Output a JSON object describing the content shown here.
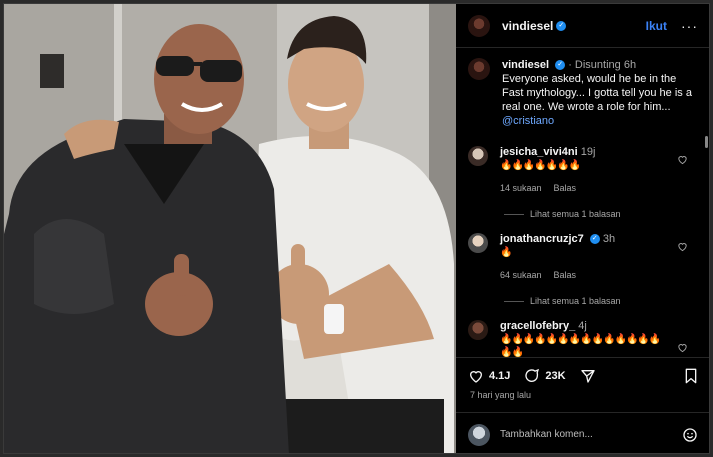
{
  "post": {
    "username": "vindiesel",
    "follow_label": "Ikut",
    "more_label": "···",
    "photo_alt": "Vin Diesel and Cristiano Ronaldo giving thumbs up"
  },
  "caption": {
    "username": "vindiesel",
    "edited": "· Disunting",
    "time": "6h",
    "text": "Everyone asked, would he be in the Fast mythology... I gotta tell you he is a real one.  We wrote a role for him...",
    "mention": "@cristiano"
  },
  "comments": [
    {
      "username": "jesicha_vivi4ni",
      "time": "19j",
      "text": "🔥🔥🔥🔥🔥🔥🔥",
      "likes": "14 sukaan",
      "reply": "Balas",
      "view_replies": "Lihat semua 1 balasan",
      "verified": false
    },
    {
      "username": "jonathancruzjc7",
      "time": "3h",
      "text": "🔥",
      "likes": "64 sukaan",
      "reply": "Balas",
      "view_replies": "Lihat semua 1 balasan",
      "verified": true
    },
    {
      "username": "gracellofebry_",
      "time": "4j",
      "text": "🔥🔥🔥🔥🔥🔥🔥🔥🔥🔥🔥🔥🔥🔥🔥🔥",
      "verified": false
    }
  ],
  "actions": {
    "likes": "4.1J",
    "comments": "23K"
  },
  "timestamp": "7 hari yang lalu",
  "add_comment": {
    "placeholder": "Tambahkan komen..."
  },
  "colors": {
    "accent": "#3b82f6",
    "verified": "#1f8ef1",
    "background": "#000000"
  }
}
